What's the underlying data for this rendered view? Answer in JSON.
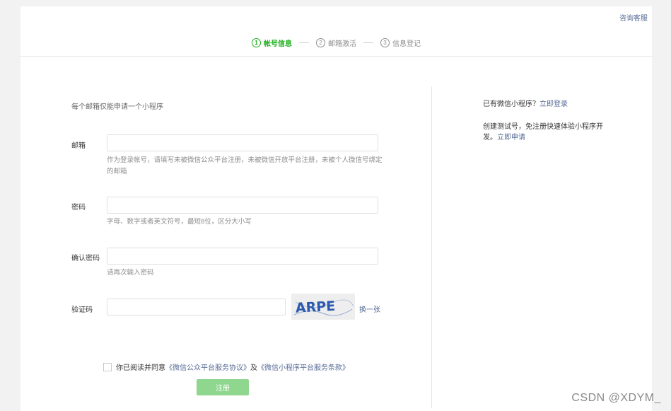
{
  "header": {
    "help_link": "咨询客服"
  },
  "steps": [
    {
      "num": "1",
      "label": "帐号信息",
      "active": true
    },
    {
      "num": "2",
      "label": "邮箱激活",
      "active": false
    },
    {
      "num": "3",
      "label": "信息登记",
      "active": false
    }
  ],
  "form": {
    "intro": "每个邮箱仅能申请一个小程序",
    "email": {
      "label": "邮箱",
      "value": "",
      "hint": "作为登录帐号，请填写未被微信公众平台注册，未被微信开放平台注册，未被个人微信号绑定的邮箱"
    },
    "password": {
      "label": "密码",
      "value": "",
      "hint": "字母、数字或者英文符号，最短8位，区分大小写"
    },
    "confirm": {
      "label": "确认密码",
      "value": "",
      "hint": "请再次输入密码"
    },
    "captcha": {
      "label": "验证码",
      "value": "",
      "image_text": "ARPE",
      "change_label": "换一张"
    },
    "agreement": {
      "prefix": "你已阅读并同意",
      "link1": "《微信公众平台服务协议》",
      "middle": "及",
      "link2": "《微信小程序平台服务条款》",
      "checked": false
    },
    "submit_label": "注册"
  },
  "sidebar": {
    "has_account_text": "已有微信小程序？",
    "login_link": "立即登录",
    "test_text": "创建测试号，免注册快速体验小程序开发。",
    "apply_link": "立即申请"
  },
  "watermark": "CSDN @XDYM_",
  "colors": {
    "accent_green": "#1aad19",
    "link_blue": "#576b95",
    "button_disabled": "#8fd68e"
  }
}
